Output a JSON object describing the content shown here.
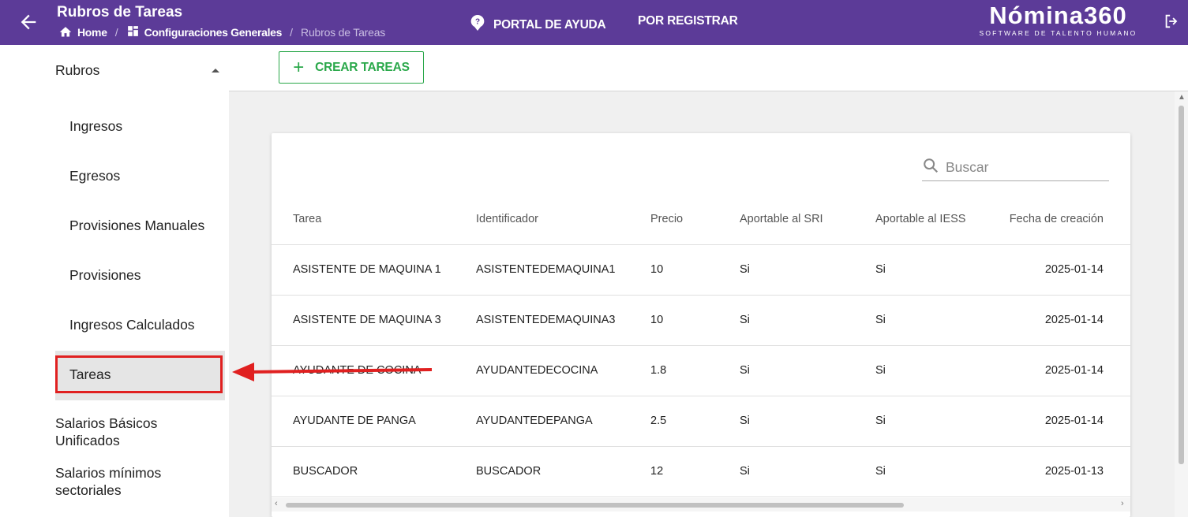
{
  "header": {
    "title": "Rubros de Tareas",
    "breadcrumb": {
      "home": "Home",
      "config": "Configuraciones Generales",
      "current": "Rubros de Tareas"
    },
    "help_label": "PORTAL DE AYUDA",
    "register_label": "POR REGISTRAR",
    "logo_brand": "Nómina360",
    "logo_tagline": "SOFTWARE DE TALENTO HUMANO"
  },
  "sidebar": {
    "group_label": "Rubros",
    "items": [
      {
        "label": "Ingresos"
      },
      {
        "label": "Egresos"
      },
      {
        "label": "Provisiones Manuales"
      },
      {
        "label": "Provisiones"
      },
      {
        "label": "Ingresos Calculados"
      },
      {
        "label": "Tareas"
      }
    ],
    "salarios_basicos": "Salarios Básicos Unificados",
    "salarios_minimos": "Salarios mínimos sectoriales"
  },
  "toolbar": {
    "create_label": "CREAR TAREAS"
  },
  "search": {
    "placeholder": "Buscar"
  },
  "table": {
    "headers": [
      "Tarea",
      "Identificador",
      "Precio",
      "Aportable al SRI",
      "Aportable al IESS",
      "Fecha de creación"
    ],
    "rows": [
      [
        "ASISTENTE DE MAQUINA 1",
        "ASISTENTEDEMAQUINA1",
        "10",
        "Si",
        "Si",
        "2025-01-14"
      ],
      [
        "ASISTENTE DE MAQUINA 3",
        "ASISTENTEDEMAQUINA3",
        "10",
        "Si",
        "Si",
        "2025-01-14"
      ],
      [
        "AYUDANTE DE COCINA",
        "AYUDANTEDECOCINA",
        "1.8",
        "Si",
        "Si",
        "2025-01-14"
      ],
      [
        "AYUDANTE DE PANGA",
        "AYUDANTEDEPANGA",
        "2.5",
        "Si",
        "Si",
        "2025-01-14"
      ],
      [
        "BUSCADOR",
        "BUSCADOR",
        "12",
        "Si",
        "Si",
        "2025-01-13"
      ]
    ]
  },
  "colors": {
    "header_bg": "#5c3b98",
    "accent_green": "#2aa84a",
    "annotation_red": "#e02020"
  },
  "icons": [
    "back-arrow-icon",
    "home-icon",
    "grid-icon",
    "help-icon",
    "logout-icon",
    "chevron-up-icon",
    "plus-icon",
    "search-icon"
  ]
}
